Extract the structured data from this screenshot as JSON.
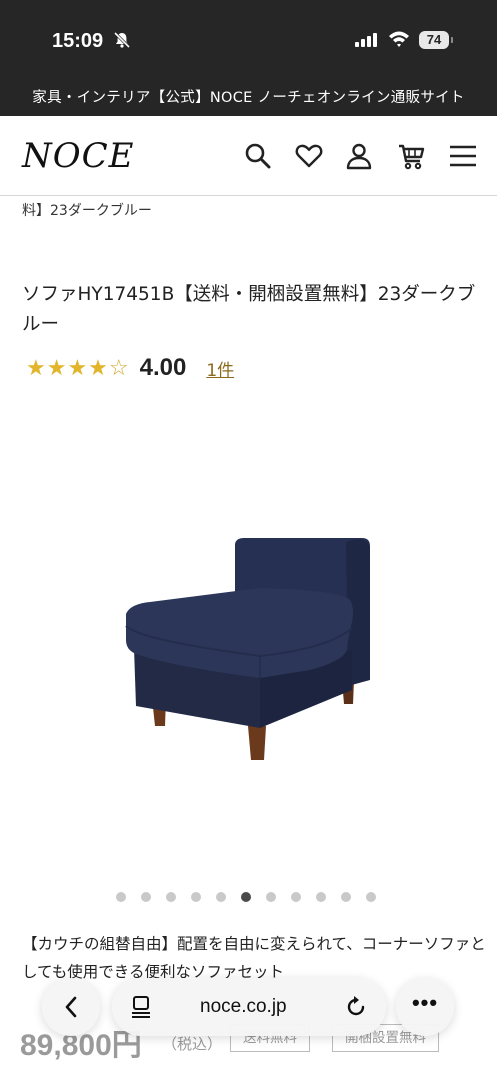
{
  "status": {
    "time": "15:09",
    "battery": "74"
  },
  "banner": {
    "text": "家具・インテリア【公式】NOCE ノーチェオンライン通販サイト"
  },
  "header": {
    "logo": "NOCE",
    "icons": [
      "search-icon",
      "heart-icon",
      "user-icon",
      "cart-icon",
      "menu-icon"
    ]
  },
  "breadcrumb": {
    "text": "料】23ダークブルー"
  },
  "product": {
    "title": "ソファHY17451B【送料・開梱設置無料】23ダークブルー",
    "stars": "★★★★",
    "star_empty": "☆",
    "rating": "4.00",
    "review_count": "1件",
    "carousel": {
      "total": 11,
      "active_index": 5
    },
    "description": "【カウチの組替自由】配置を自由に変えられて、コーナーソファとしても使用できる便利なソファセット",
    "price": "89,800円",
    "tax": "（税込）",
    "tags": [
      "送料無料",
      "開梱設置無料"
    ]
  },
  "browser": {
    "url": "noce.co.jp"
  },
  "colors": {
    "dark": "#262626",
    "star": "#e2b52b",
    "sofa": "#2a3250",
    "leg": "#6b3a1c"
  }
}
